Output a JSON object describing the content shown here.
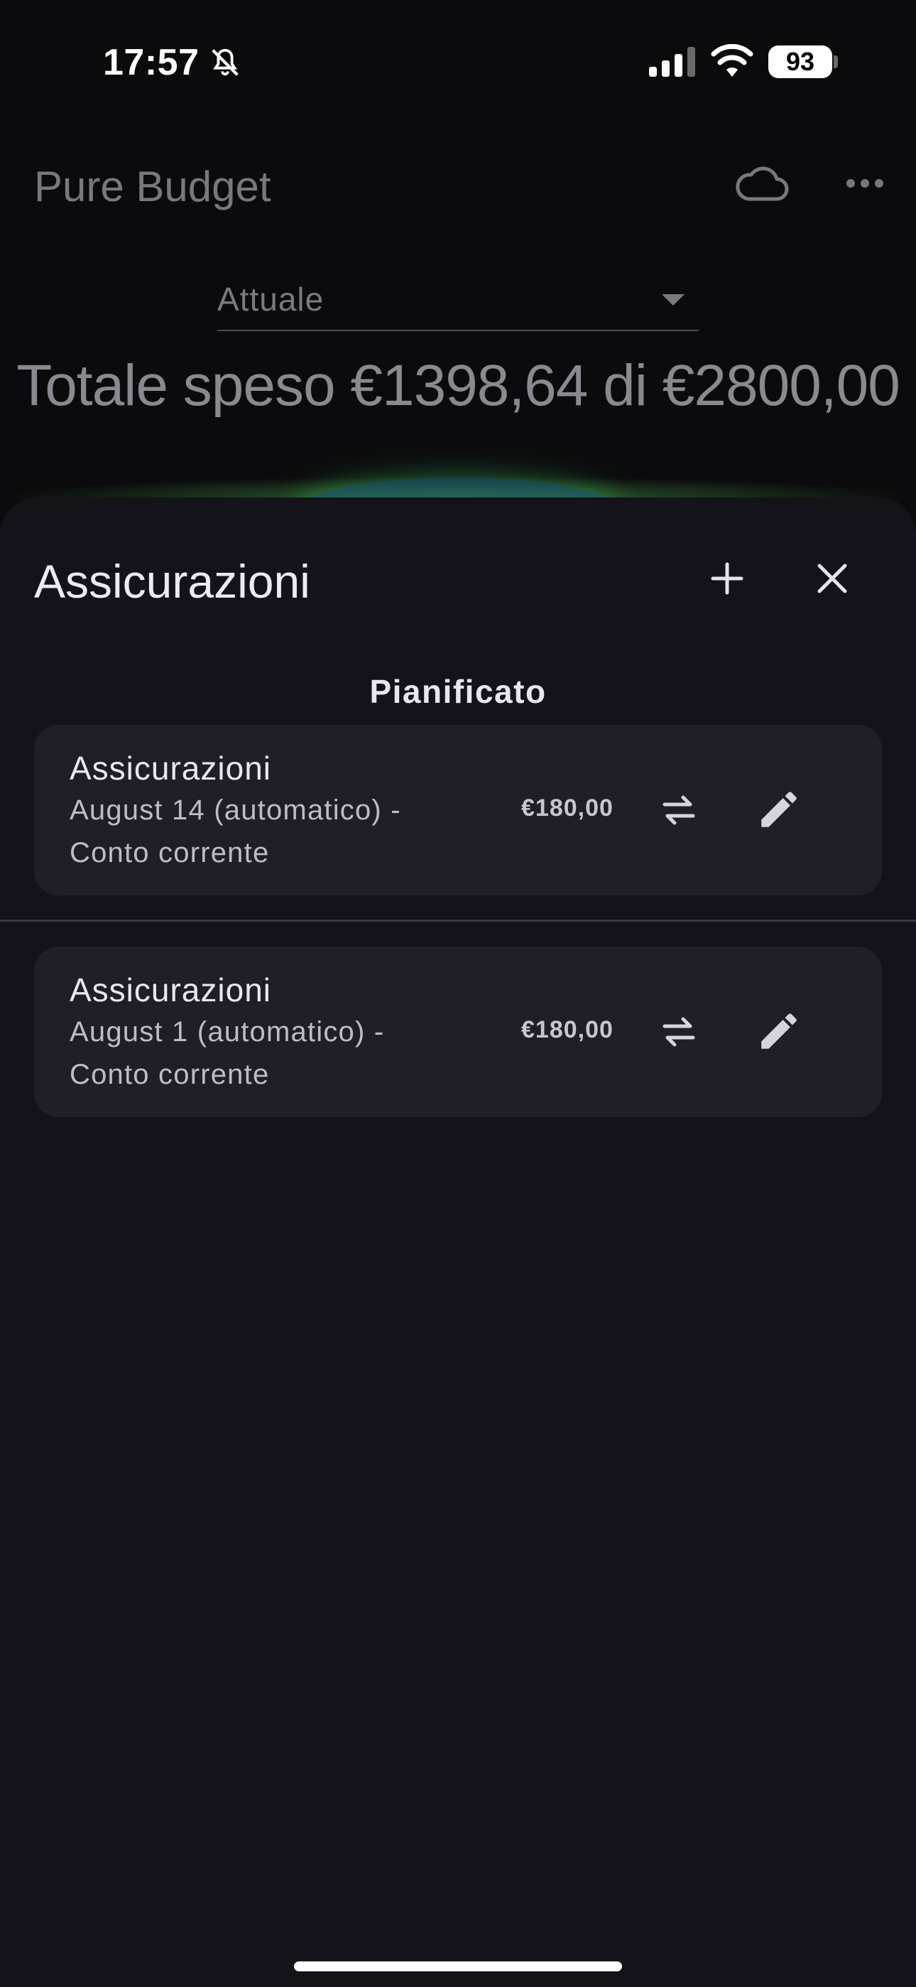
{
  "status_bar": {
    "time": "17:57",
    "battery": "93"
  },
  "app": {
    "title": "Pure Budget",
    "period": "Attuale",
    "total_line": "Totale speso €1398,64 di €2800,00"
  },
  "sheet": {
    "title": "Assicurazioni",
    "section": "Pianificato",
    "items": [
      {
        "name": "Assicurazioni",
        "schedule": "August 14 (automatico) -",
        "account": "Conto corrente",
        "amount": "€180,00"
      },
      {
        "name": "Assicurazioni",
        "schedule": "August 1 (automatico) -",
        "account": "Conto corrente",
        "amount": "€180,00"
      }
    ]
  },
  "icons": {
    "bell": "bell-slash-icon",
    "signal": "cellular-signal-icon",
    "wifi": "wifi-icon",
    "cloud": "cloud-icon",
    "more": "more-horizontal-icon",
    "add": "plus-icon",
    "close": "close-icon",
    "transfer": "swap-arrows-icon",
    "edit": "pencil-icon"
  },
  "colors": {
    "background": "#0b0b0d",
    "sheet": "#141319",
    "card": "#201f25",
    "accent_glow": "#3cbf5a"
  }
}
